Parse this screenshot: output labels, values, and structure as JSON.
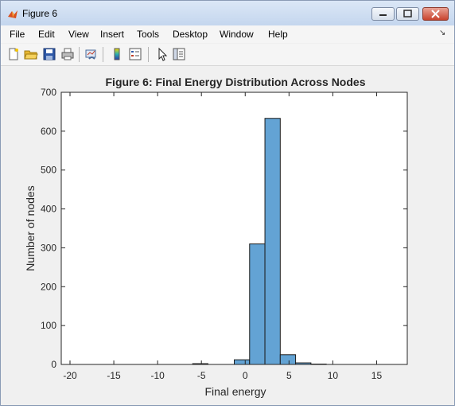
{
  "window": {
    "title": "Figure 6"
  },
  "menu": [
    "File",
    "Edit",
    "View",
    "Insert",
    "Tools",
    "Desktop",
    "Window",
    "Help"
  ],
  "toolbar": {
    "icons": [
      "new-figure-icon",
      "open-file-icon",
      "save-icon",
      "print-icon",
      "link-plot-icon",
      "insert-colorbar-icon",
      "insert-legend-icon",
      "edit-plot-icon",
      "property-inspector-icon"
    ]
  },
  "colors": {
    "bar_fill": "#63a3d4",
    "bar_edge": "#1a1a1a",
    "titlebar": "#c4d6ee",
    "close": "#c8432d"
  },
  "chart_data": {
    "type": "bar",
    "title": "Figure 6: Final Energy Distribution Across Nodes",
    "xlabel": "Final energy",
    "ylabel": "Number of nodes",
    "xlim": [
      -21,
      18.5
    ],
    "ylim": [
      0,
      700
    ],
    "xticks": [
      -20,
      -15,
      -10,
      -5,
      0,
      5,
      10,
      15
    ],
    "yticks": [
      0,
      100,
      200,
      300,
      400,
      500,
      600,
      700
    ],
    "bin_width": 1.75,
    "bins": [
      {
        "x0": -6.0,
        "value": 2
      },
      {
        "x0": -1.25,
        "value": 12
      },
      {
        "x0": 0.5,
        "value": 310
      },
      {
        "x0": 2.25,
        "value": 633
      },
      {
        "x0": 4.0,
        "value": 25
      },
      {
        "x0": 5.75,
        "value": 4
      },
      {
        "x0": 7.5,
        "value": 1
      }
    ],
    "grid": false
  }
}
